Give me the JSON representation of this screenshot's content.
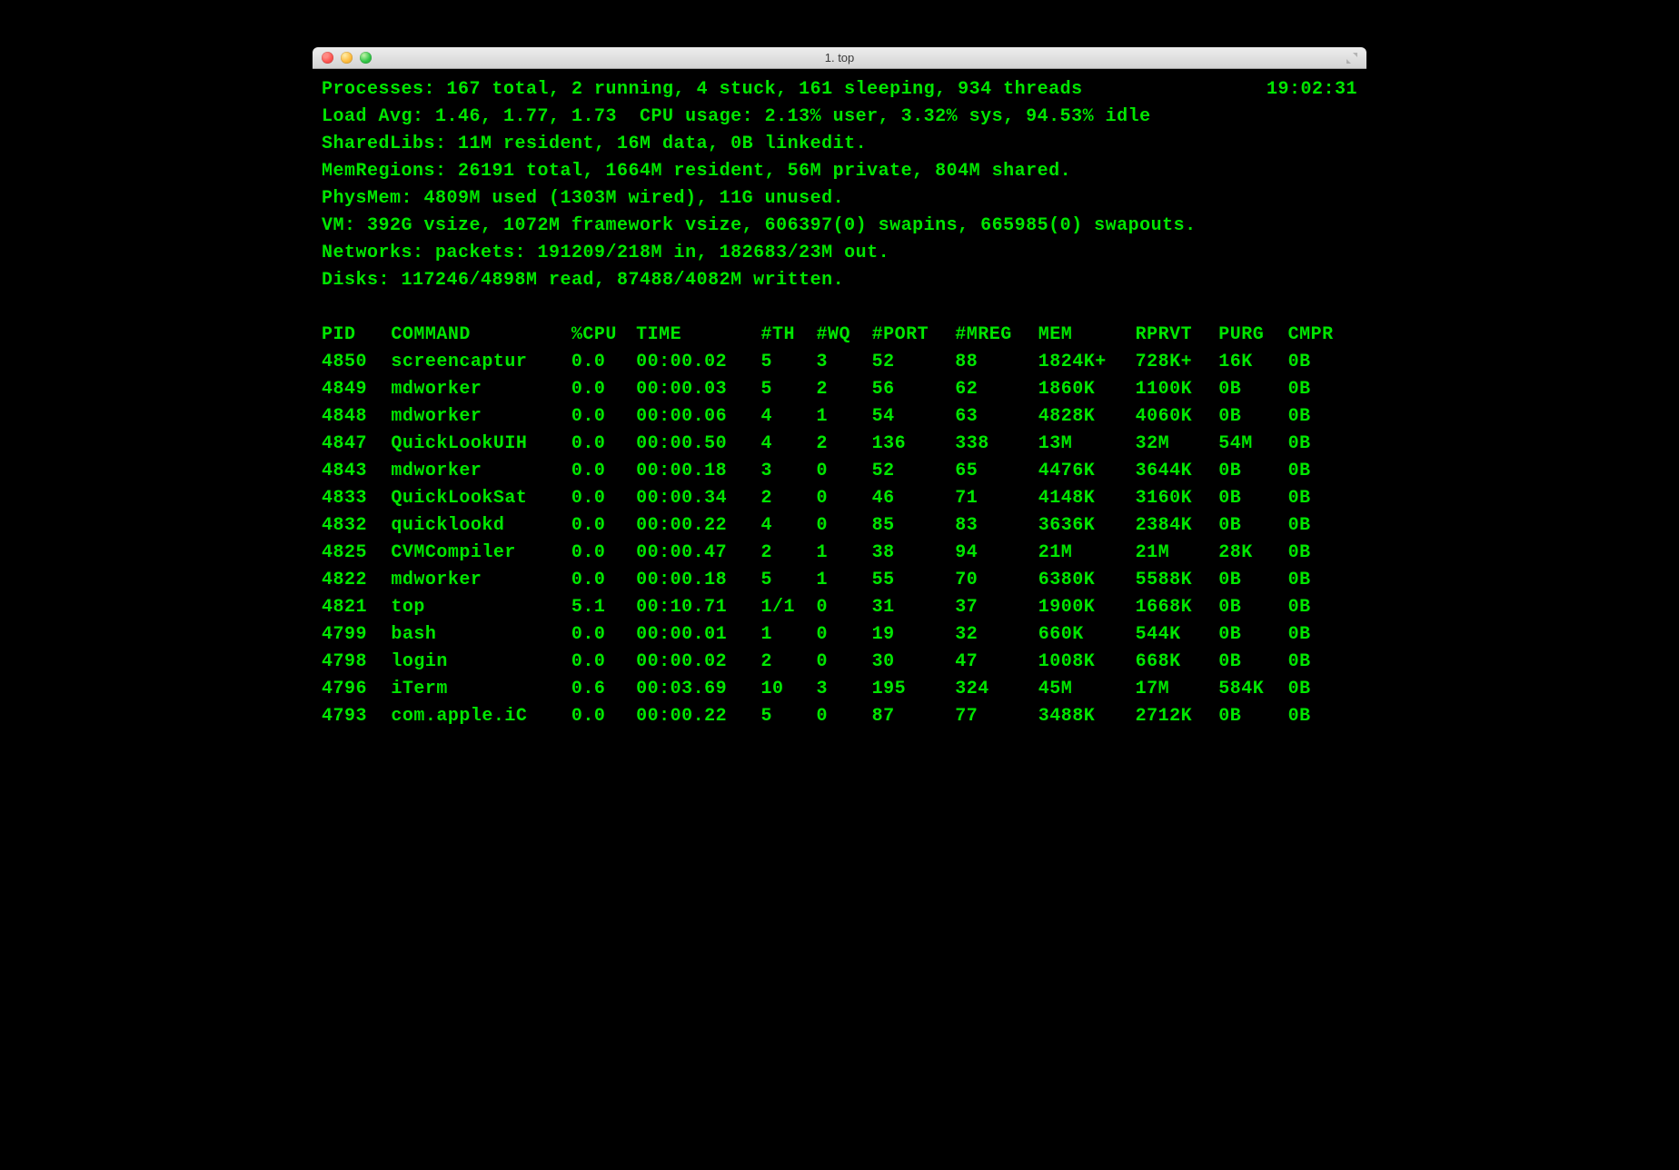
{
  "window": {
    "title": "1. top"
  },
  "summary": {
    "processes": "Processes: 167 total, 2 running, 4 stuck, 161 sleeping, 934 threads",
    "clock": "19:02:31",
    "load_cpu": "Load Avg: 1.46, 1.77, 1.73  CPU usage: 2.13% user, 3.32% sys, 94.53% idle",
    "sharedlibs": "SharedLibs: 11M resident, 16M data, 0B linkedit.",
    "memregions": "MemRegions: 26191 total, 1664M resident, 56M private, 804M shared.",
    "physmem": "PhysMem: 4809M used (1303M wired), 11G unused.",
    "vm": "VM: 392G vsize, 1072M framework vsize, 606397(0) swapins, 665985(0) swapouts.",
    "networks": "Networks: packets: 191209/218M in, 182683/23M out.",
    "disks": "Disks: 117246/4898M read, 87488/4082M written."
  },
  "columns": {
    "pid": "PID",
    "command": "COMMAND",
    "cpu": "%CPU",
    "time": "TIME",
    "th": "#TH",
    "wq": "#WQ",
    "port": "#PORT",
    "mreg": "#MREG",
    "mem": "MEM",
    "rprvt": "RPRVT",
    "purg": "PURG",
    "cmpr": "CMPR"
  },
  "rows": [
    {
      "pid": "4850",
      "command": "screencaptur",
      "cpu": "0.0",
      "time": "00:00.02",
      "th": "5",
      "wq": "3",
      "port": "52",
      "mreg": "88",
      "mem": "1824K+",
      "rprvt": "728K+",
      "purg": "16K",
      "cmpr": "0B"
    },
    {
      "pid": "4849",
      "command": "mdworker",
      "cpu": "0.0",
      "time": "00:00.03",
      "th": "5",
      "wq": "2",
      "port": "56",
      "mreg": "62",
      "mem": "1860K",
      "rprvt": "1100K",
      "purg": "0B",
      "cmpr": "0B"
    },
    {
      "pid": "4848",
      "command": "mdworker",
      "cpu": "0.0",
      "time": "00:00.06",
      "th": "4",
      "wq": "1",
      "port": "54",
      "mreg": "63",
      "mem": "4828K",
      "rprvt": "4060K",
      "purg": "0B",
      "cmpr": "0B"
    },
    {
      "pid": "4847",
      "command": "QuickLookUIH",
      "cpu": "0.0",
      "time": "00:00.50",
      "th": "4",
      "wq": "2",
      "port": "136",
      "mreg": "338",
      "mem": "13M",
      "rprvt": "32M",
      "purg": "54M",
      "cmpr": "0B"
    },
    {
      "pid": "4843",
      "command": "mdworker",
      "cpu": "0.0",
      "time": "00:00.18",
      "th": "3",
      "wq": "0",
      "port": "52",
      "mreg": "65",
      "mem": "4476K",
      "rprvt": "3644K",
      "purg": "0B",
      "cmpr": "0B"
    },
    {
      "pid": "4833",
      "command": "QuickLookSat",
      "cpu": "0.0",
      "time": "00:00.34",
      "th": "2",
      "wq": "0",
      "port": "46",
      "mreg": "71",
      "mem": "4148K",
      "rprvt": "3160K",
      "purg": "0B",
      "cmpr": "0B"
    },
    {
      "pid": "4832",
      "command": "quicklookd",
      "cpu": "0.0",
      "time": "00:00.22",
      "th": "4",
      "wq": "0",
      "port": "85",
      "mreg": "83",
      "mem": "3636K",
      "rprvt": "2384K",
      "purg": "0B",
      "cmpr": "0B"
    },
    {
      "pid": "4825",
      "command": "CVMCompiler",
      "cpu": "0.0",
      "time": "00:00.47",
      "th": "2",
      "wq": "1",
      "port": "38",
      "mreg": "94",
      "mem": "21M",
      "rprvt": "21M",
      "purg": "28K",
      "cmpr": "0B"
    },
    {
      "pid": "4822",
      "command": "mdworker",
      "cpu": "0.0",
      "time": "00:00.18",
      "th": "5",
      "wq": "1",
      "port": "55",
      "mreg": "70",
      "mem": "6380K",
      "rprvt": "5588K",
      "purg": "0B",
      "cmpr": "0B"
    },
    {
      "pid": "4821",
      "command": "top",
      "cpu": "5.1",
      "time": "00:10.71",
      "th": "1/1",
      "wq": "0",
      "port": "31",
      "mreg": "37",
      "mem": "1900K",
      "rprvt": "1668K",
      "purg": "0B",
      "cmpr": "0B"
    },
    {
      "pid": "4799",
      "command": "bash",
      "cpu": "0.0",
      "time": "00:00.01",
      "th": "1",
      "wq": "0",
      "port": "19",
      "mreg": "32",
      "mem": "660K",
      "rprvt": "544K",
      "purg": "0B",
      "cmpr": "0B"
    },
    {
      "pid": "4798",
      "command": "login",
      "cpu": "0.0",
      "time": "00:00.02",
      "th": "2",
      "wq": "0",
      "port": "30",
      "mreg": "47",
      "mem": "1008K",
      "rprvt": "668K",
      "purg": "0B",
      "cmpr": "0B"
    },
    {
      "pid": "4796",
      "command": "iTerm",
      "cpu": "0.6",
      "time": "00:03.69",
      "th": "10",
      "wq": "3",
      "port": "195",
      "mreg": "324",
      "mem": "45M",
      "rprvt": "17M",
      "purg": "584K",
      "cmpr": "0B"
    },
    {
      "pid": "4793",
      "command": "com.apple.iC",
      "cpu": "0.0",
      "time": "00:00.22",
      "th": "5",
      "wq": "0",
      "port": "87",
      "mreg": "77",
      "mem": "3488K",
      "rprvt": "2712K",
      "purg": "0B",
      "cmpr": "0B"
    }
  ]
}
